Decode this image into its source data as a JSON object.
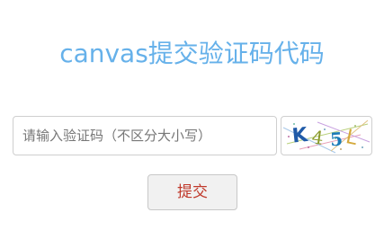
{
  "page": {
    "title": "canvas提交验证码代码"
  },
  "form": {
    "input_placeholder": "请输入验证码（不区分大小写）",
    "input_value": "",
    "captcha_chars": [
      "K",
      "4",
      "5",
      "L"
    ],
    "captcha_colors": [
      "#1f5aa8",
      "#8a9a2a",
      "#1a7ab8",
      "#d4a93a"
    ],
    "submit_label": "提交"
  },
  "colors": {
    "title": "#66b1ea",
    "submit_text": "#c0392b"
  }
}
